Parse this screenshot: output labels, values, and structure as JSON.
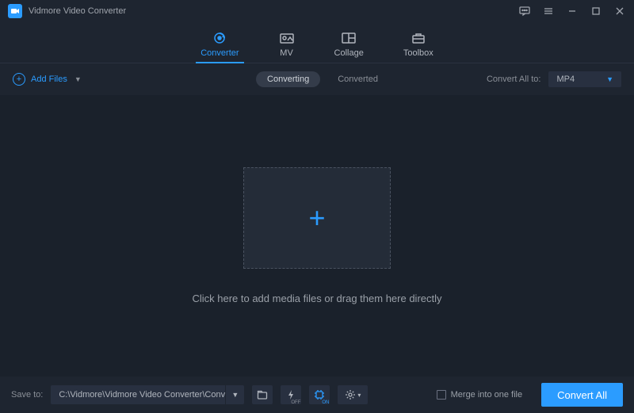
{
  "app": {
    "title": "Vidmore Video Converter"
  },
  "nav": {
    "converter": "Converter",
    "mv": "MV",
    "collage": "Collage",
    "toolbox": "Toolbox"
  },
  "toolbar": {
    "add_files": "Add Files",
    "converting": "Converting",
    "converted": "Converted",
    "convert_all_to": "Convert All to:",
    "format": "MP4"
  },
  "main": {
    "drop_text": "Click here to add media files or drag them here directly"
  },
  "footer": {
    "save_to": "Save to:",
    "path": "C:\\Vidmore\\Vidmore Video Converter\\Converted",
    "merge": "Merge into one file",
    "convert_all": "Convert All",
    "lightning_sub_off": "OFF",
    "gpu_sub_on": "ON"
  }
}
